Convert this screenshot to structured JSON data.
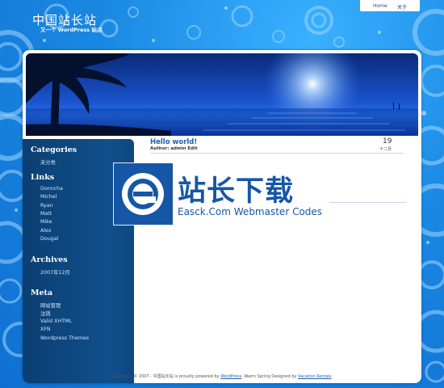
{
  "site": {
    "title": "中国站长站",
    "description": "又一个 WordPress 站点"
  },
  "topnav": {
    "home_label": "Home",
    "about_label": "关于"
  },
  "sidebar": {
    "categories": {
      "heading": "Categories",
      "items": [
        "未分类"
      ]
    },
    "links": {
      "heading": "Links",
      "items": [
        "Donncha",
        "Michel",
        "Ryan",
        "Matt",
        "Mike",
        "Alex",
        "Dougal"
      ]
    },
    "archives": {
      "heading": "Archives",
      "items": [
        "2007年12月"
      ]
    },
    "meta": {
      "heading": "Meta",
      "items": [
        "网站管理",
        "注销",
        "Valid XHTML",
        "XFN",
        "Wordpress Themes"
      ]
    }
  },
  "post": {
    "title": "Hello world!",
    "meta": "Author: admin Edit",
    "day": "19",
    "month": "十二月"
  },
  "watermark": {
    "chinese": "站长下载",
    "english": "Easck.Com Webmaster Codes"
  },
  "footer": {
    "copyright": "Copyright © 2007 - 中国站长站",
    "powered_prefix": "is proudly powered by",
    "powered_link": "WordPress",
    "theme_text": ". Warm Spring Designed by",
    "designer_link": "Vacation Rentals"
  },
  "colors": {
    "background": "#1e8fe6",
    "sidebar": "#114f8c",
    "link": "#1a5fb0",
    "watermark": "#1656a6"
  }
}
